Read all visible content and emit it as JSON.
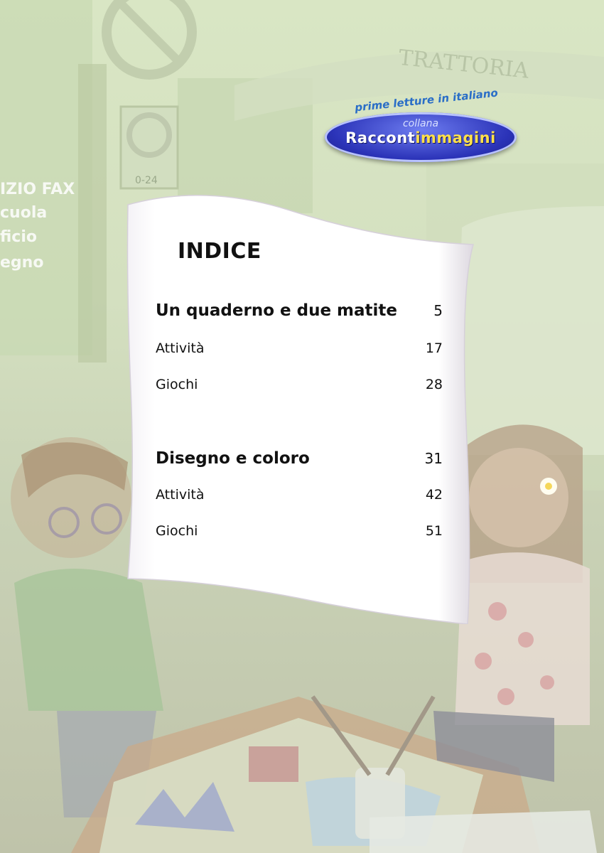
{
  "logo": {
    "tagline": "prime letture in italiano",
    "series_prefix": "collana",
    "name_part1": "Raccont",
    "name_part2": "immagini"
  },
  "background": {
    "sign_left": [
      "IZIO FAX",
      "cuola",
      "ficio",
      "egno"
    ],
    "sign_top": "TRATTORIA",
    "parking_hours": "0-24"
  },
  "index": {
    "title": "INDICE",
    "sections": [
      {
        "title": "Un quaderno e due matite",
        "page": "5",
        "items": [
          {
            "label": "Attività",
            "page": "17"
          },
          {
            "label": "Giochi",
            "page": "28"
          }
        ]
      },
      {
        "title": "Disegno e coloro",
        "page": "31",
        "items": [
          {
            "label": "Attività",
            "page": "42"
          },
          {
            "label": "Giochi",
            "page": "51"
          }
        ]
      }
    ]
  },
  "colors": {
    "logo_blue": "#2b33b8",
    "logo_yellow": "#ffe04a",
    "tagline_blue": "#2a6ec7",
    "background_green": "#d9e6c4"
  }
}
